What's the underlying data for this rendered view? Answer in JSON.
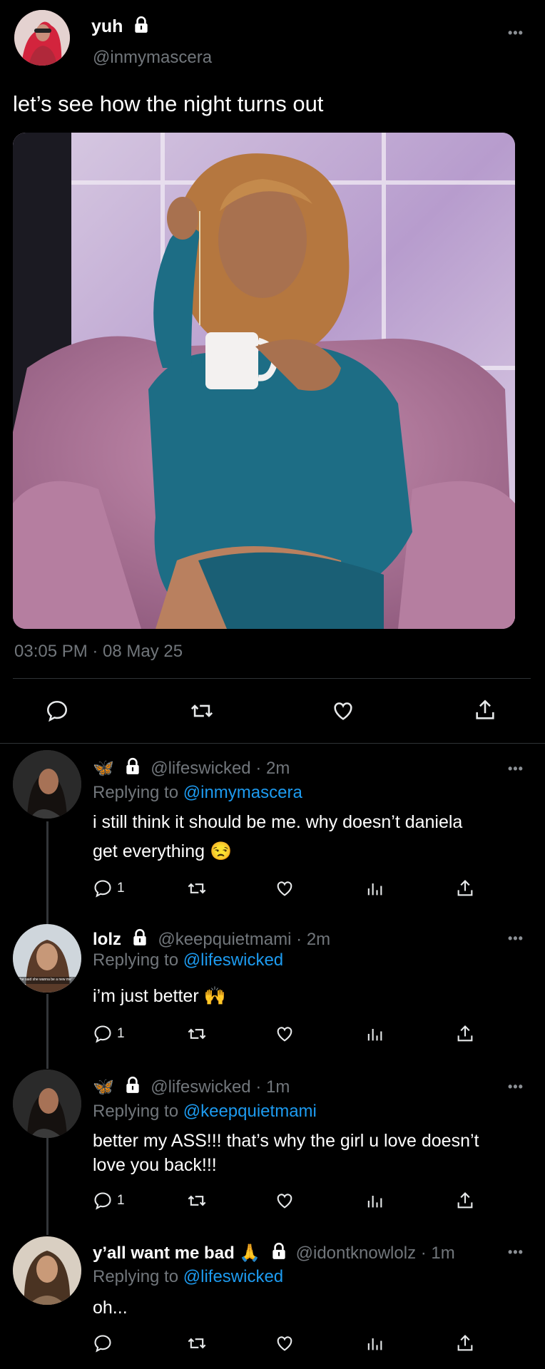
{
  "main_tweet": {
    "display_name": "yuh",
    "handle": "@inmymascera",
    "text": "let’s see how the night turns out",
    "timestamp": "03:05 PM · 08 May 25"
  },
  "replies": [
    {
      "emoji": "🦋",
      "handle": "@lifeswicked",
      "time": "2m",
      "replying_label": "Replying to",
      "replying_to": "@inmymascera",
      "text_line1": "i still think it should be me. why doesn’t daniela",
      "text_line2": "get everything 😒",
      "reply_count": "1"
    },
    {
      "display_name": "lolz",
      "handle": "@keepquietmami",
      "time": "2m",
      "replying_label": "Replying to",
      "replying_to": "@lifeswicked",
      "text": "i’m just better 🙌",
      "reply_count": "1",
      "avatar_caption": "“she said she wanna be a new me”"
    },
    {
      "emoji": "🦋",
      "handle": "@lifeswicked",
      "time": "1m",
      "replying_label": "Replying to",
      "replying_to": "@keepquietmami",
      "text_line1": "better my ASS!!! that’s why the girl u love doesn’t",
      "text_line2": "love you back!!!",
      "reply_count": "1"
    },
    {
      "display_name": "y’all want me bad 🙏",
      "handle": "@idontknowlolz",
      "time": "1m",
      "replying_label": "Replying to",
      "replying_to": "@lifeswicked",
      "text": "oh...",
      "reply_count": ""
    }
  ],
  "separator": "·",
  "more_label": "•••",
  "icons": [
    "lock-icon",
    "reply-icon",
    "retweet-icon",
    "like-icon",
    "analytics-icon",
    "share-icon",
    "more-icon"
  ],
  "colors": {
    "background": "#000000",
    "link": "#1d9bf0",
    "muted": "#71767b",
    "divider": "#2f3336"
  }
}
